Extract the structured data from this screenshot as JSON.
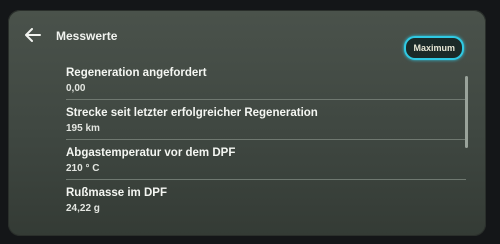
{
  "header": {
    "title": "Messwerte",
    "action_label": "Maximum"
  },
  "icons": {
    "back": "back-arrow-icon"
  },
  "colors": {
    "accent": "#2fc9e3",
    "background": "#4a524b"
  },
  "measurements": [
    {
      "label": "Regeneration angefordert",
      "value": "0,00"
    },
    {
      "label": "Strecke seit letzter erfolgreicher Regeneration",
      "value": "195 km"
    },
    {
      "label": "Abgastemperatur vor dem DPF",
      "value": "210 ° C"
    },
    {
      "label": "Rußmasse im DPF",
      "value": "24,22 g"
    }
  ]
}
